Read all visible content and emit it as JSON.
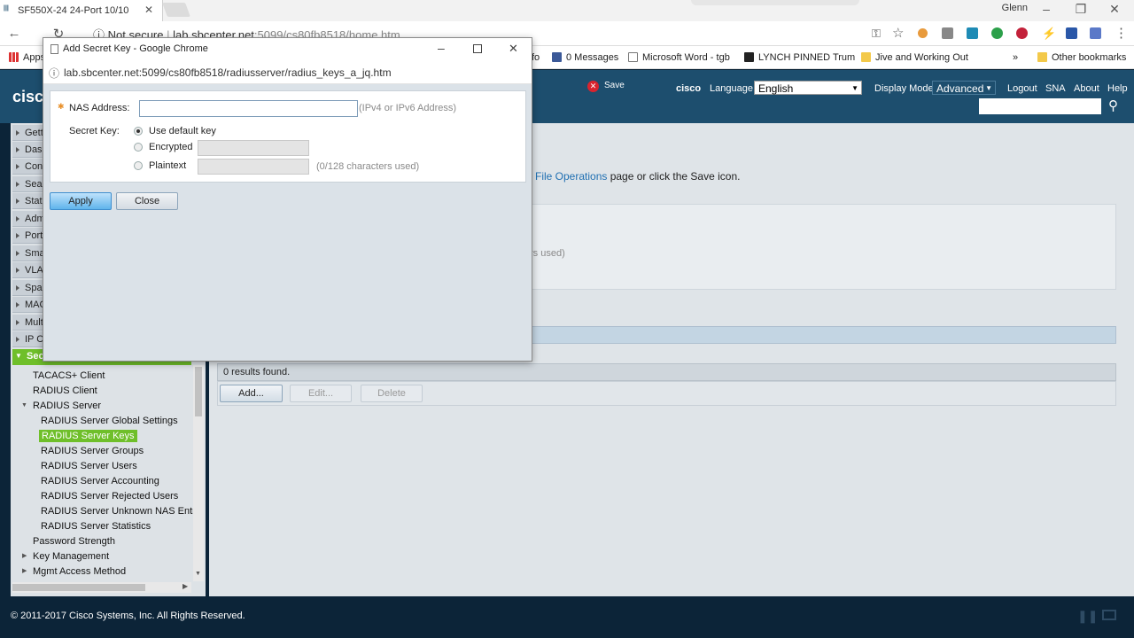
{
  "browser": {
    "tab_title": "SF550X-24 24-Port 10/10",
    "user_name": "Glenn",
    "address_prefix": "Not secure",
    "address_host": "lab.sbcenter.net",
    "address_path": ":5099/cs80fb8518/home.htm",
    "bookmarks": [
      {
        "label": "Apps"
      },
      {
        "label": "0 Messages"
      },
      {
        "label": "Microsoft Word - tgb"
      },
      {
        "label": "LYNCH PINNED Trum"
      },
      {
        "label": "Jive and Working Out"
      },
      {
        "label": "»"
      },
      {
        "label": "Other bookmarks"
      }
    ],
    "bookmark_fragment": "fo"
  },
  "app": {
    "logo_text": "cisco",
    "save_label": "Save",
    "cisco_user": "cisco",
    "language_label": "Language:",
    "language_value": "English",
    "display_mode_label": "Display Mode:",
    "display_mode_value": "Advanced",
    "logout": "Logout",
    "sna": "SNA",
    "about": "About",
    "help": "Help",
    "left_nav_truncated": [
      "Gett",
      "Das",
      "Con",
      "Sea",
      "Stat",
      "Adm",
      "Port",
      "Sma",
      "VLA",
      "Spa",
      "MAC",
      "Mult",
      "IP C",
      "Sec"
    ],
    "security_submenu": [
      "TACACS+ Client",
      "RADIUS Client",
      "RADIUS Server"
    ],
    "radius_server_items": [
      "RADIUS Server Global Settings",
      "RADIUS Server Keys",
      "RADIUS Server Groups",
      "RADIUS Server Users",
      "RADIUS Server Accounting",
      "RADIUS Server Rejected Users",
      "RADIUS Server Unknown NAS Entrie",
      "RADIUS Server Statistics"
    ],
    "more_items": [
      "Password Strength",
      "Key Management",
      "Mgmt Access Method"
    ],
    "main_note_link": "File Operations",
    "main_note_text": " page or click the Save icon.",
    "main_fragment": "rs used)",
    "results_text": "0 results found.",
    "add_button": "Add...",
    "edit_button": "Edit...",
    "delete_button": "Delete",
    "footer": "© 2011-2017 Cisco Systems, Inc. All Rights Reserved."
  },
  "popup": {
    "window_title": "Add Secret Key - Google Chrome",
    "url": "lab.sbcenter.net:5099/cs80fb8518/radiusserver/radius_keys_a_jq.htm",
    "nas_label": "NAS Address:",
    "nas_value": "",
    "nas_hint": "(IPv4 or IPv6 Address)",
    "secret_key_label": "Secret Key:",
    "opt_default": "Use default key",
    "opt_encrypted": "Encrypted",
    "opt_plaintext": "Plaintext",
    "chars_used": "(0/128 characters used)",
    "apply": "Apply",
    "close": "Close"
  }
}
